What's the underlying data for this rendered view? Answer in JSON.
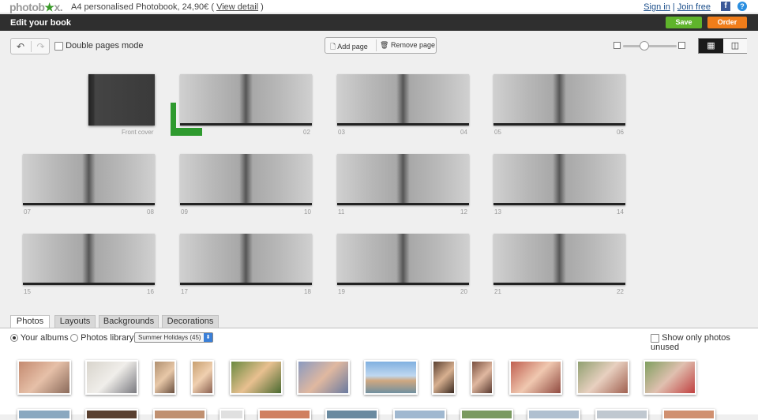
{
  "topbar": {
    "logo": "photobox.",
    "product": "A4 personalised Photobook, 24,90€ (",
    "view_detail": "View detail",
    "product_close": ")",
    "sign_in": "Sign in",
    "sep": "|",
    "join_free": "Join free"
  },
  "editbar": {
    "title": "Edit your book",
    "save": "Save",
    "order": "Order"
  },
  "toolbar": {
    "double_pages": "Double pages mode",
    "add_page": "Add page",
    "remove_page": "Remove page"
  },
  "pages": {
    "front_cover": "Front cover",
    "labels": [
      "02",
      "03",
      "04",
      "05",
      "06",
      "07",
      "08",
      "09",
      "10",
      "11",
      "12",
      "13",
      "14",
      "15",
      "16",
      "17",
      "18",
      "19",
      "20",
      "21",
      "22"
    ]
  },
  "tabs": [
    "Photos",
    "Layouts",
    "Backgrounds",
    "Decorations"
  ],
  "panel": {
    "your_albums": "Your albums",
    "photos_library": "Photos library",
    "album_select": "Summer Holidays (45)",
    "show_unused": "Show only photos unused"
  },
  "colors": {
    "save": "#5fb42b",
    "order": "#f07d1a",
    "darkbar": "#2f2f2f"
  }
}
